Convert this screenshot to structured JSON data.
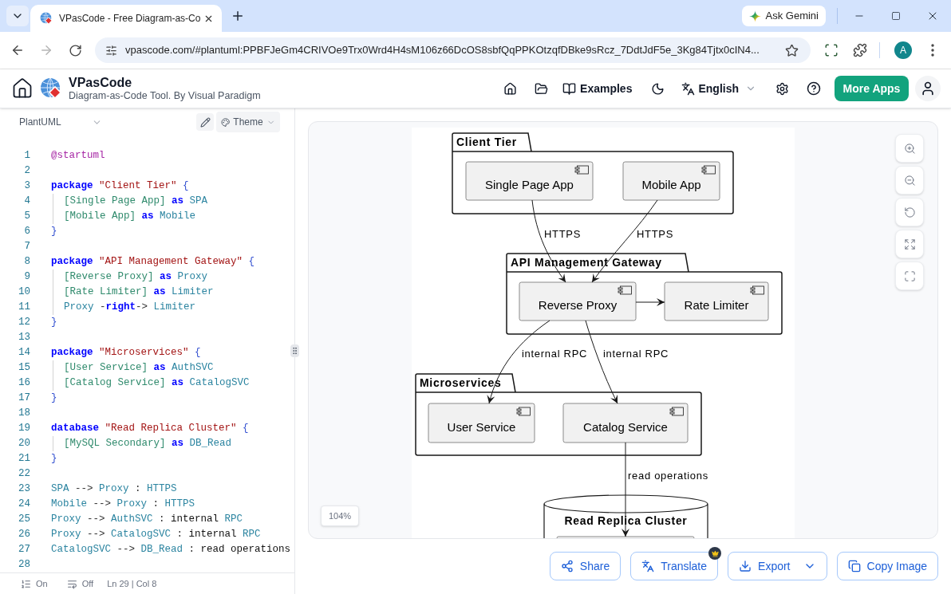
{
  "browser": {
    "tabs": [
      {
        "title": "VPasCode - Free Diagram-as-Co",
        "selected": true
      }
    ],
    "gemini_button": "Ask Gemini",
    "forward_disabled": true,
    "address": "vpascode.com/#plantuml:PPBFJeGm4CRIVOe9Trx0Wrd4H4sM106z66DcOS8sbfQqPPKOtzqfDBke9sRcz_7DdtJdF5e_3Kg84Tjtx0cIN4...",
    "profile_initial": "A"
  },
  "header": {
    "title": "VPasCode",
    "subtitle": "Diagram-as-Code Tool. By Visual Paradigm",
    "examples": "Examples",
    "language": "English",
    "more_apps": "More Apps"
  },
  "editor": {
    "language": "PlantUML",
    "theme": "Theme",
    "lines": [
      {
        "number": "1",
        "indented": false,
        "tokens": [
          {
            "kind": "directive",
            "text": "@startuml"
          }
        ]
      },
      {
        "number": "2"
      },
      {
        "number": "3",
        "indented": false,
        "tokens": [
          {
            "kind": "keyword",
            "text": "package"
          },
          {
            "kind": "string",
            "text": " \"Client Tier\""
          },
          {
            "kind": "brace",
            "text": " {"
          }
        ]
      },
      {
        "number": "4",
        "indented": true,
        "tokens": [
          {
            "kind": "component",
            "text": "[Single Page App]"
          },
          {
            "kind": "keyword",
            "text": " as"
          },
          {
            "kind": "ident",
            "text": " SPA"
          }
        ]
      },
      {
        "number": "5",
        "indented": true,
        "tokens": [
          {
            "kind": "component",
            "text": "[Mobile App]"
          },
          {
            "kind": "keyword",
            "text": " as"
          },
          {
            "kind": "ident",
            "text": " Mobile"
          }
        ]
      },
      {
        "number": "6",
        "indented": false,
        "tokens": [
          {
            "kind": "brace",
            "text": "}"
          }
        ]
      },
      {
        "number": "7"
      },
      {
        "number": "8",
        "indented": false,
        "tokens": [
          {
            "kind": "keyword",
            "text": "package"
          },
          {
            "kind": "string",
            "text": " \"API Management Gateway\""
          },
          {
            "kind": "brace",
            "text": " {"
          }
        ]
      },
      {
        "number": "9",
        "indented": true,
        "tokens": [
          {
            "kind": "component",
            "text": "[Reverse Proxy]"
          },
          {
            "kind": "keyword",
            "text": " as"
          },
          {
            "kind": "ident",
            "text": " Proxy"
          }
        ]
      },
      {
        "number": "10",
        "indented": true,
        "tokens": [
          {
            "kind": "component",
            "text": "[Rate Limiter]"
          },
          {
            "kind": "keyword",
            "text": " as"
          },
          {
            "kind": "ident",
            "text": " Limiter"
          }
        ]
      },
      {
        "number": "11",
        "indented": true,
        "tokens": [
          {
            "kind": "ident",
            "text": "Proxy"
          },
          {
            "kind": "op",
            "text": " -"
          },
          {
            "kind": "keyword",
            "text": "right"
          },
          {
            "kind": "op",
            "text": "->"
          },
          {
            "kind": "ident",
            "text": " Limiter"
          }
        ]
      },
      {
        "number": "12",
        "indented": false,
        "tokens": [
          {
            "kind": "brace",
            "text": "}"
          }
        ]
      },
      {
        "number": "13"
      },
      {
        "number": "14",
        "indented": false,
        "tokens": [
          {
            "kind": "keyword",
            "text": "package"
          },
          {
            "kind": "string",
            "text": " \"Microservices\""
          },
          {
            "kind": "brace",
            "text": " {"
          }
        ]
      },
      {
        "number": "15",
        "indented": true,
        "tokens": [
          {
            "kind": "component",
            "text": "[User Service]"
          },
          {
            "kind": "keyword",
            "text": " as"
          },
          {
            "kind": "ident",
            "text": " AuthSVC"
          }
        ]
      },
      {
        "number": "16",
        "indented": true,
        "tokens": [
          {
            "kind": "component",
            "text": "[Catalog Service]"
          },
          {
            "kind": "keyword",
            "text": " as"
          },
          {
            "kind": "ident",
            "text": " CatalogSVC"
          }
        ]
      },
      {
        "number": "17",
        "indented": false,
        "tokens": [
          {
            "kind": "brace",
            "text": "}"
          }
        ]
      },
      {
        "number": "18"
      },
      {
        "number": "19",
        "indented": false,
        "tokens": [
          {
            "kind": "keyword",
            "text": "database"
          },
          {
            "kind": "string",
            "text": " \"Read Replica Cluster\""
          },
          {
            "kind": "brace",
            "text": " {"
          }
        ]
      },
      {
        "number": "20",
        "indented": true,
        "tokens": [
          {
            "kind": "component",
            "text": "[MySQL Secondary]"
          },
          {
            "kind": "keyword",
            "text": " as"
          },
          {
            "kind": "ident",
            "text": " DB_Read"
          }
        ]
      },
      {
        "number": "21",
        "indented": false,
        "tokens": [
          {
            "kind": "brace",
            "text": "}"
          }
        ]
      },
      {
        "number": "22"
      },
      {
        "number": "23",
        "indented": false,
        "tokens": [
          {
            "kind": "ident",
            "text": "SPA"
          },
          {
            "kind": "op",
            "text": " -->"
          },
          {
            "kind": "ident",
            "text": " Proxy"
          },
          {
            "kind": "op",
            "text": " :"
          },
          {
            "kind": "ident",
            "text": " HTTPS"
          }
        ]
      },
      {
        "number": "24",
        "indented": false,
        "tokens": [
          {
            "kind": "ident",
            "text": "Mobile"
          },
          {
            "kind": "op",
            "text": " -->"
          },
          {
            "kind": "ident",
            "text": " Proxy"
          },
          {
            "kind": "op",
            "text": " :"
          },
          {
            "kind": "ident",
            "text": " HTTPS"
          }
        ]
      },
      {
        "number": "25",
        "indented": false,
        "tokens": [
          {
            "kind": "ident",
            "text": "Proxy"
          },
          {
            "kind": "op",
            "text": " -->"
          },
          {
            "kind": "ident",
            "text": " AuthSVC"
          },
          {
            "kind": "op",
            "text": " :"
          },
          {
            "kind": "text",
            "text": " internal"
          },
          {
            "kind": "ident",
            "text": " RPC"
          }
        ]
      },
      {
        "number": "26",
        "indented": false,
        "tokens": [
          {
            "kind": "ident",
            "text": "Proxy"
          },
          {
            "kind": "op",
            "text": " -->"
          },
          {
            "kind": "ident",
            "text": " CatalogSVC"
          },
          {
            "kind": "op",
            "text": " :"
          },
          {
            "kind": "text",
            "text": " internal"
          },
          {
            "kind": "ident",
            "text": " RPC"
          }
        ]
      },
      {
        "number": "27",
        "indented": false,
        "tokens": [
          {
            "kind": "ident",
            "text": "CatalogSVC"
          },
          {
            "kind": "op",
            "text": " -->"
          },
          {
            "kind": "ident",
            "text": " DB_Read"
          },
          {
            "kind": "op",
            "text": " :"
          },
          {
            "kind": "text",
            "text": " read operations"
          }
        ]
      },
      {
        "number": "28"
      }
    ],
    "status": {
      "line_numbers": "On",
      "word_wrap": "Off",
      "cursor": "Ln 29 | Col 8"
    }
  },
  "diagram": {
    "zoom": "104%",
    "groups": [
      {
        "kind": "package",
        "title": "Client Tier",
        "components": [
          "Single Page App",
          "Mobile App"
        ]
      },
      {
        "kind": "package",
        "title": "API Management Gateway",
        "components": [
          "Reverse Proxy",
          "Rate Limiter"
        ]
      },
      {
        "kind": "package",
        "title": "Microservices",
        "components": [
          "User Service",
          "Catalog Service"
        ]
      },
      {
        "kind": "database",
        "title": "Read Replica Cluster"
      }
    ],
    "edges": [
      {
        "label": "HTTPS"
      },
      {
        "label": "HTTPS"
      },
      {
        "label": "internal RPC"
      },
      {
        "label": "internal RPC"
      },
      {
        "label": "read operations"
      }
    ]
  },
  "actions": [
    {
      "kind": "share",
      "label": "Share",
      "premium": false
    },
    {
      "kind": "translate",
      "label": "Translate",
      "premium": true
    },
    {
      "kind": "export",
      "label": "Export",
      "premium": false
    },
    {
      "kind": "copy",
      "label": "Copy Image",
      "premium": false
    }
  ]
}
